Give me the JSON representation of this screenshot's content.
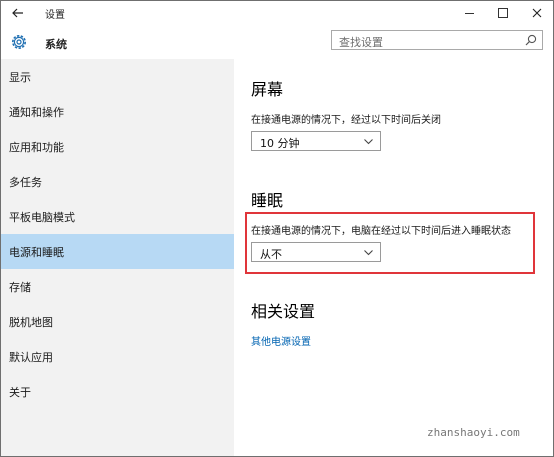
{
  "titlebar": {
    "title": "设置"
  },
  "header": {
    "title": "系统",
    "search_placeholder": "查找设置"
  },
  "sidebar": {
    "items": [
      {
        "label": "显示"
      },
      {
        "label": "通知和操作"
      },
      {
        "label": "应用和功能"
      },
      {
        "label": "多任务"
      },
      {
        "label": "平板电脑模式"
      },
      {
        "label": "电源和睡眠",
        "selected": true
      },
      {
        "label": "存储"
      },
      {
        "label": "脱机地图"
      },
      {
        "label": "默认应用"
      },
      {
        "label": "关于"
      }
    ]
  },
  "main": {
    "screen": {
      "title": "屏幕",
      "desc": "在接通电源的情况下，经过以下时间后关闭",
      "value": "10 分钟"
    },
    "sleep": {
      "title": "睡眠",
      "desc": "在接通电源的情况下，电脑在经过以下时间后进入睡眠状态",
      "value": "从不"
    },
    "related": {
      "title": "相关设置",
      "link": "其他电源设置"
    }
  },
  "watermark": "zhanshaoyi.com",
  "colors": {
    "sidebar_bg": "#f2f2f2",
    "selected_bg": "#b7d9f4",
    "link": "#0063b1",
    "highlight": "#e0353a"
  }
}
